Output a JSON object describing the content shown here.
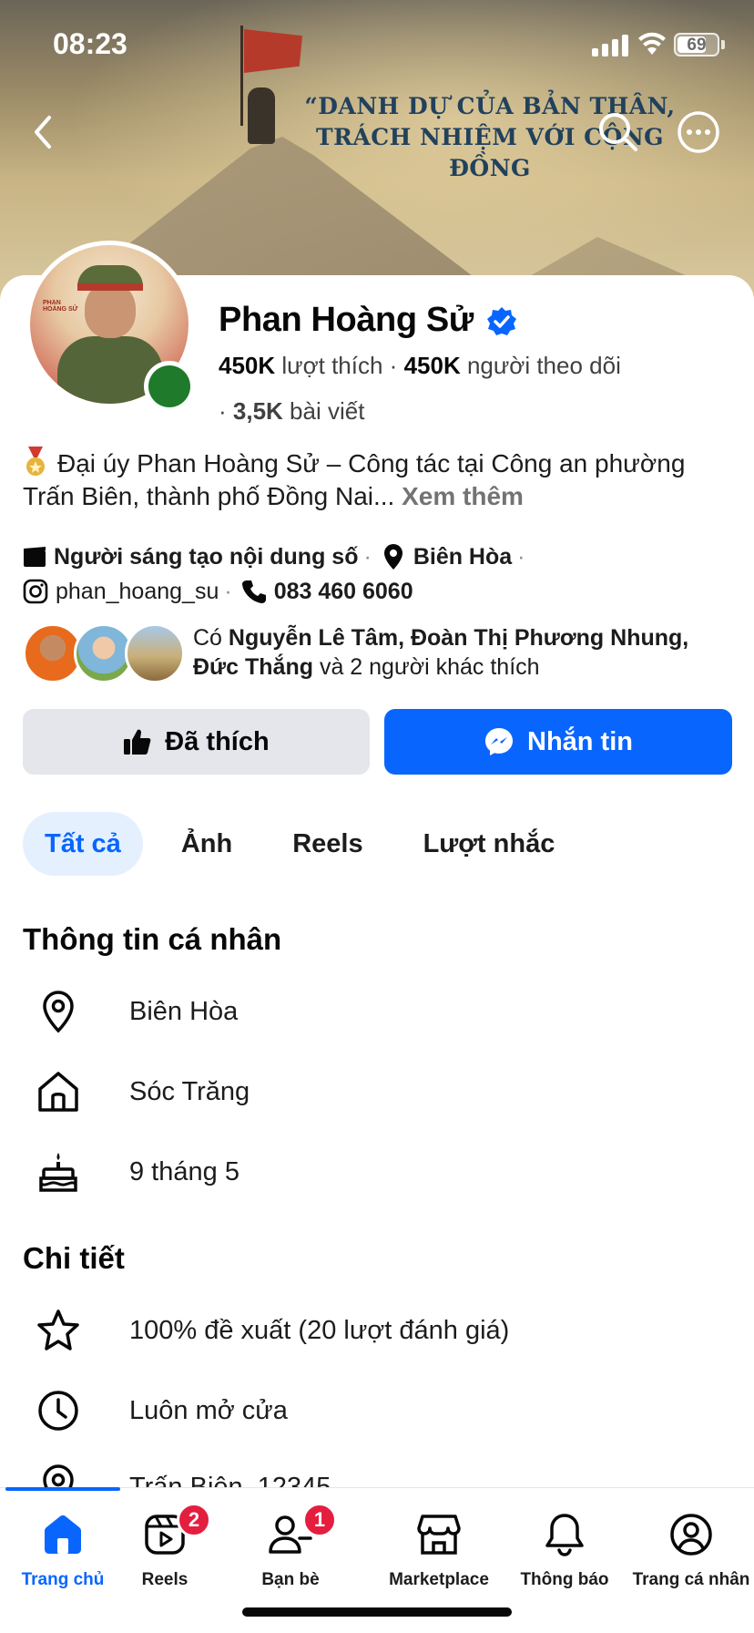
{
  "status_bar": {
    "time": "08:23",
    "battery": "69"
  },
  "cover": {
    "quote_line1": "“DANH DỰ CỦA BẢN THÂN,",
    "quote_line2": "TRÁCH NHIỆM VỚI CỘNG ĐỒNG"
  },
  "profile": {
    "name": "Phan Hoàng Sử",
    "likes_count": "450K",
    "likes_label": "lượt thích",
    "followers_count": "450K",
    "followers_label": "người theo dõi",
    "posts_count": "3,5K",
    "posts_label": "bài viết",
    "bio": "Đại úy Phan Hoàng Sử – Công tác tại Công an phường Trấn Biên, thành phố Đồng Nai...",
    "bio_more": "Xem thêm",
    "category": "Người sáng tạo nội dung số",
    "location": "Biên Hòa",
    "instagram": "phan_hoang_su",
    "phone": "083 460 6060",
    "avatar_text": "PHAN HOÀNG SỬ"
  },
  "mutual": {
    "prefix": "Có",
    "names": "Nguyễn Lê Tâm, Đoàn Thị Phương Nhung, Đức Thắng",
    "suffix": "và 2 người khác thích"
  },
  "actions": {
    "liked_label": "Đã thích",
    "message_label": "Nhắn tin"
  },
  "tabs": [
    {
      "label": "Tất cả",
      "active": true
    },
    {
      "label": "Ảnh"
    },
    {
      "label": "Reels"
    },
    {
      "label": "Lượt nhắc"
    }
  ],
  "personal_info": {
    "title": "Thông tin cá nhân",
    "items": [
      {
        "icon": "location-pin-icon",
        "text": "Biên Hòa"
      },
      {
        "icon": "home-icon",
        "text": "Sóc Trăng"
      },
      {
        "icon": "birthday-cake-icon",
        "text": "9 tháng 5"
      }
    ]
  },
  "details": {
    "title": "Chi tiết",
    "items": [
      {
        "icon": "star-icon",
        "text": "100% đề xuất (20 lượt đánh giá)"
      },
      {
        "icon": "clock-icon",
        "text": "Luôn mở cửa"
      },
      {
        "icon": "location-pin-icon",
        "text": "Trấn Biên, 12345"
      }
    ]
  },
  "bottom_nav": [
    {
      "label": "Trang chủ",
      "icon": "home-icon",
      "active": true
    },
    {
      "label": "Reels",
      "icon": "reels-icon",
      "badge": "2"
    },
    {
      "label": "Bạn bè",
      "icon": "friends-icon",
      "badge": "1"
    },
    {
      "label": "Marketplace",
      "icon": "marketplace-icon"
    },
    {
      "label": "Thông báo",
      "icon": "bell-icon"
    },
    {
      "label": "Trang cá nhân",
      "icon": "profile-icon"
    }
  ],
  "colors": {
    "accent": "#0866ff",
    "badge": "#e41e3f",
    "tab_active_bg": "#e5f0ff",
    "button_grey": "#e4e6eb"
  }
}
